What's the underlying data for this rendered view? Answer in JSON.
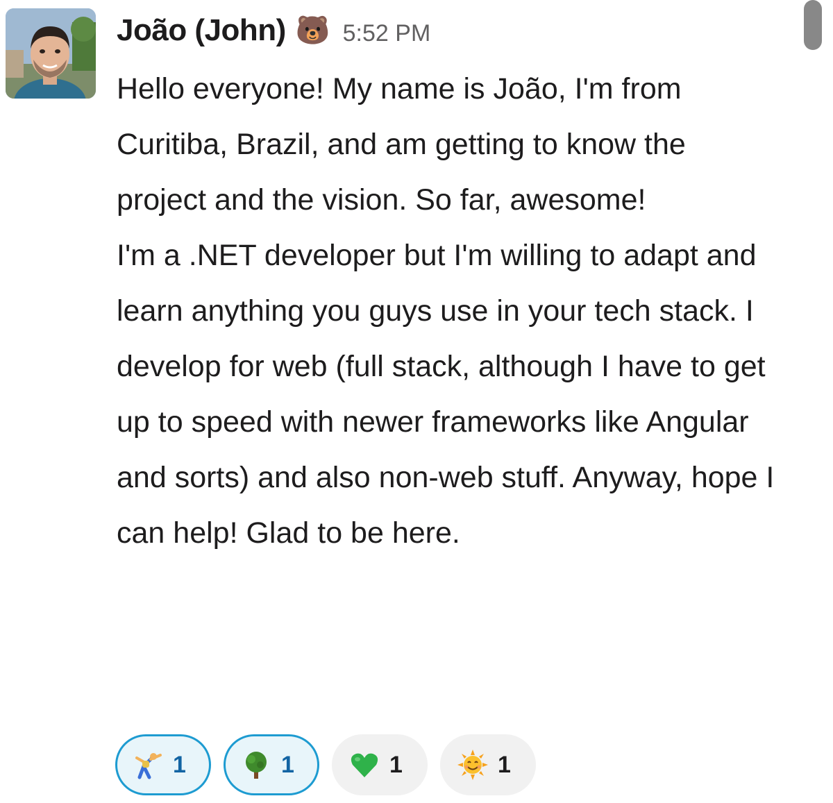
{
  "message": {
    "author": "João (John)",
    "author_status_emoji": "🐻",
    "timestamp": "5:52 PM",
    "paragraphs": [
      "Hello everyone! My name is João, I'm from Curitiba, Brazil, and am getting to know the project and the vision. So far, awesome!",
      "I'm a .NET developer but I'm willing to adapt and learn anything you guys use in your tech stack. I develop for web (full stack, although I have to get up to speed with newer  frameworks like Angular and sorts) and also non-web stuff. Anyway, hope I can help! Glad to be here."
    ]
  },
  "reactions": [
    {
      "icon": "cartwheel-emoji",
      "count": "1",
      "reacted_by_viewer": true
    },
    {
      "icon": "tree-emoji",
      "count": "1",
      "reacted_by_viewer": true
    },
    {
      "icon": "green-heart-emoji",
      "count": "1",
      "reacted_by_viewer": false
    },
    {
      "icon": "sun-with-face-emoji",
      "count": "1",
      "reacted_by_viewer": false
    }
  ],
  "colors": {
    "text": "#1d1c1d",
    "timestamp": "#616061",
    "reaction_active_border": "#1d9bd1",
    "reaction_active_bg": "#e8f5fa",
    "reaction_inactive_bg": "#f1f1f1",
    "scrollbar": "#888888"
  }
}
